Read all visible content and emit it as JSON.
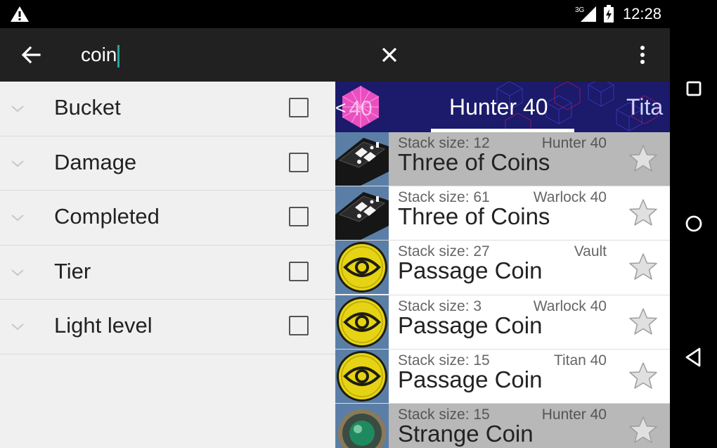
{
  "status": {
    "network": "3G",
    "time": "12:28"
  },
  "search": {
    "query": "coin"
  },
  "filters": [
    {
      "label": "Bucket"
    },
    {
      "label": "Damage"
    },
    {
      "label": "Completed"
    },
    {
      "label": "Tier"
    },
    {
      "label": "Light level"
    }
  ],
  "tabs": {
    "level": "40",
    "prev_arrow": "<",
    "active": "Hunter 40",
    "next": "Tita"
  },
  "items": [
    {
      "stack": "Stack size: 12",
      "character": "Hunter 40",
      "name": "Three of Coins",
      "icon": "three-of-coins-icon",
      "highlighted": true
    },
    {
      "stack": "Stack size: 61",
      "character": "Warlock 40",
      "name": "Three of Coins",
      "icon": "three-of-coins-icon",
      "highlighted": false
    },
    {
      "stack": "Stack size: 27",
      "character": "Vault",
      "name": "Passage Coin",
      "icon": "passage-coin-icon",
      "highlighted": false
    },
    {
      "stack": "Stack size: 3",
      "character": "Warlock 40",
      "name": "Passage Coin",
      "icon": "passage-coin-icon",
      "highlighted": false
    },
    {
      "stack": "Stack size: 15",
      "character": "Titan 40",
      "name": "Passage Coin",
      "icon": "passage-coin-icon",
      "highlighted": false
    },
    {
      "stack": "Stack size: 15",
      "character": "Hunter 40",
      "name": "Strange Coin",
      "icon": "strange-coin-icon",
      "highlighted": true
    }
  ],
  "colors": {
    "toolbar": "#212121",
    "accent": "#26a69a",
    "tab_bg": "#1b1a6b",
    "highlight_row": "#b8b8b8",
    "passage_coin": "#e6d313"
  }
}
